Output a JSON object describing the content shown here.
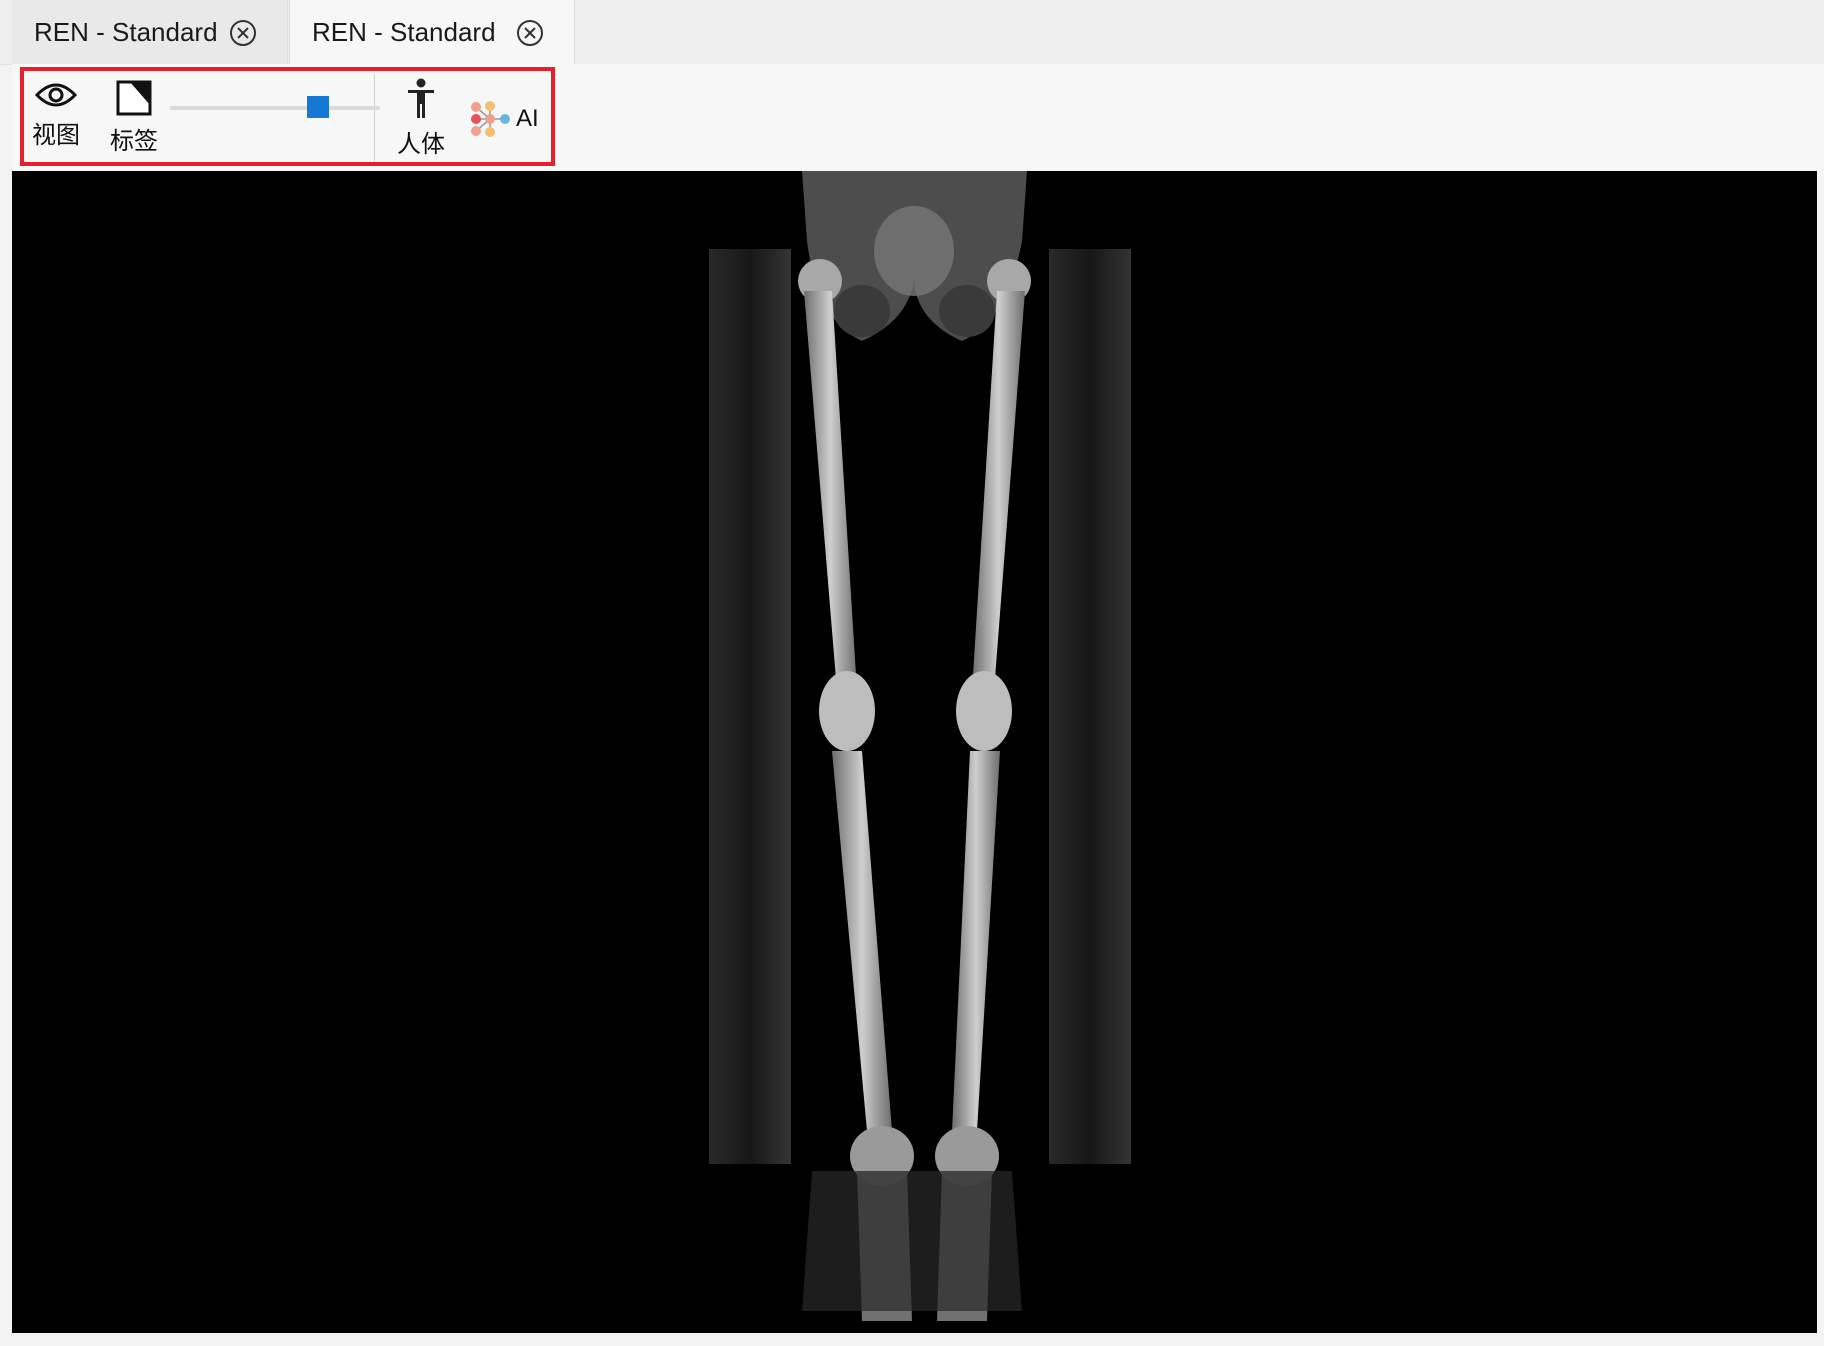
{
  "tabs": [
    {
      "label": "REN - Standard",
      "active": false
    },
    {
      "label": "REN - Standard",
      "active": true
    }
  ],
  "toolbar": {
    "view_label": "视图",
    "label_label": "标签",
    "body_label": "人体",
    "ai_label": "AI",
    "opacity_value": 0.73
  },
  "colors": {
    "highlight": "#e3202c",
    "slider_thumb": "#1478d4",
    "viewport_bg": "#000000"
  },
  "icons": [
    "eye-icon",
    "label-tag-icon",
    "human-body-icon",
    "ai-network-icon",
    "close-circle-icon"
  ]
}
